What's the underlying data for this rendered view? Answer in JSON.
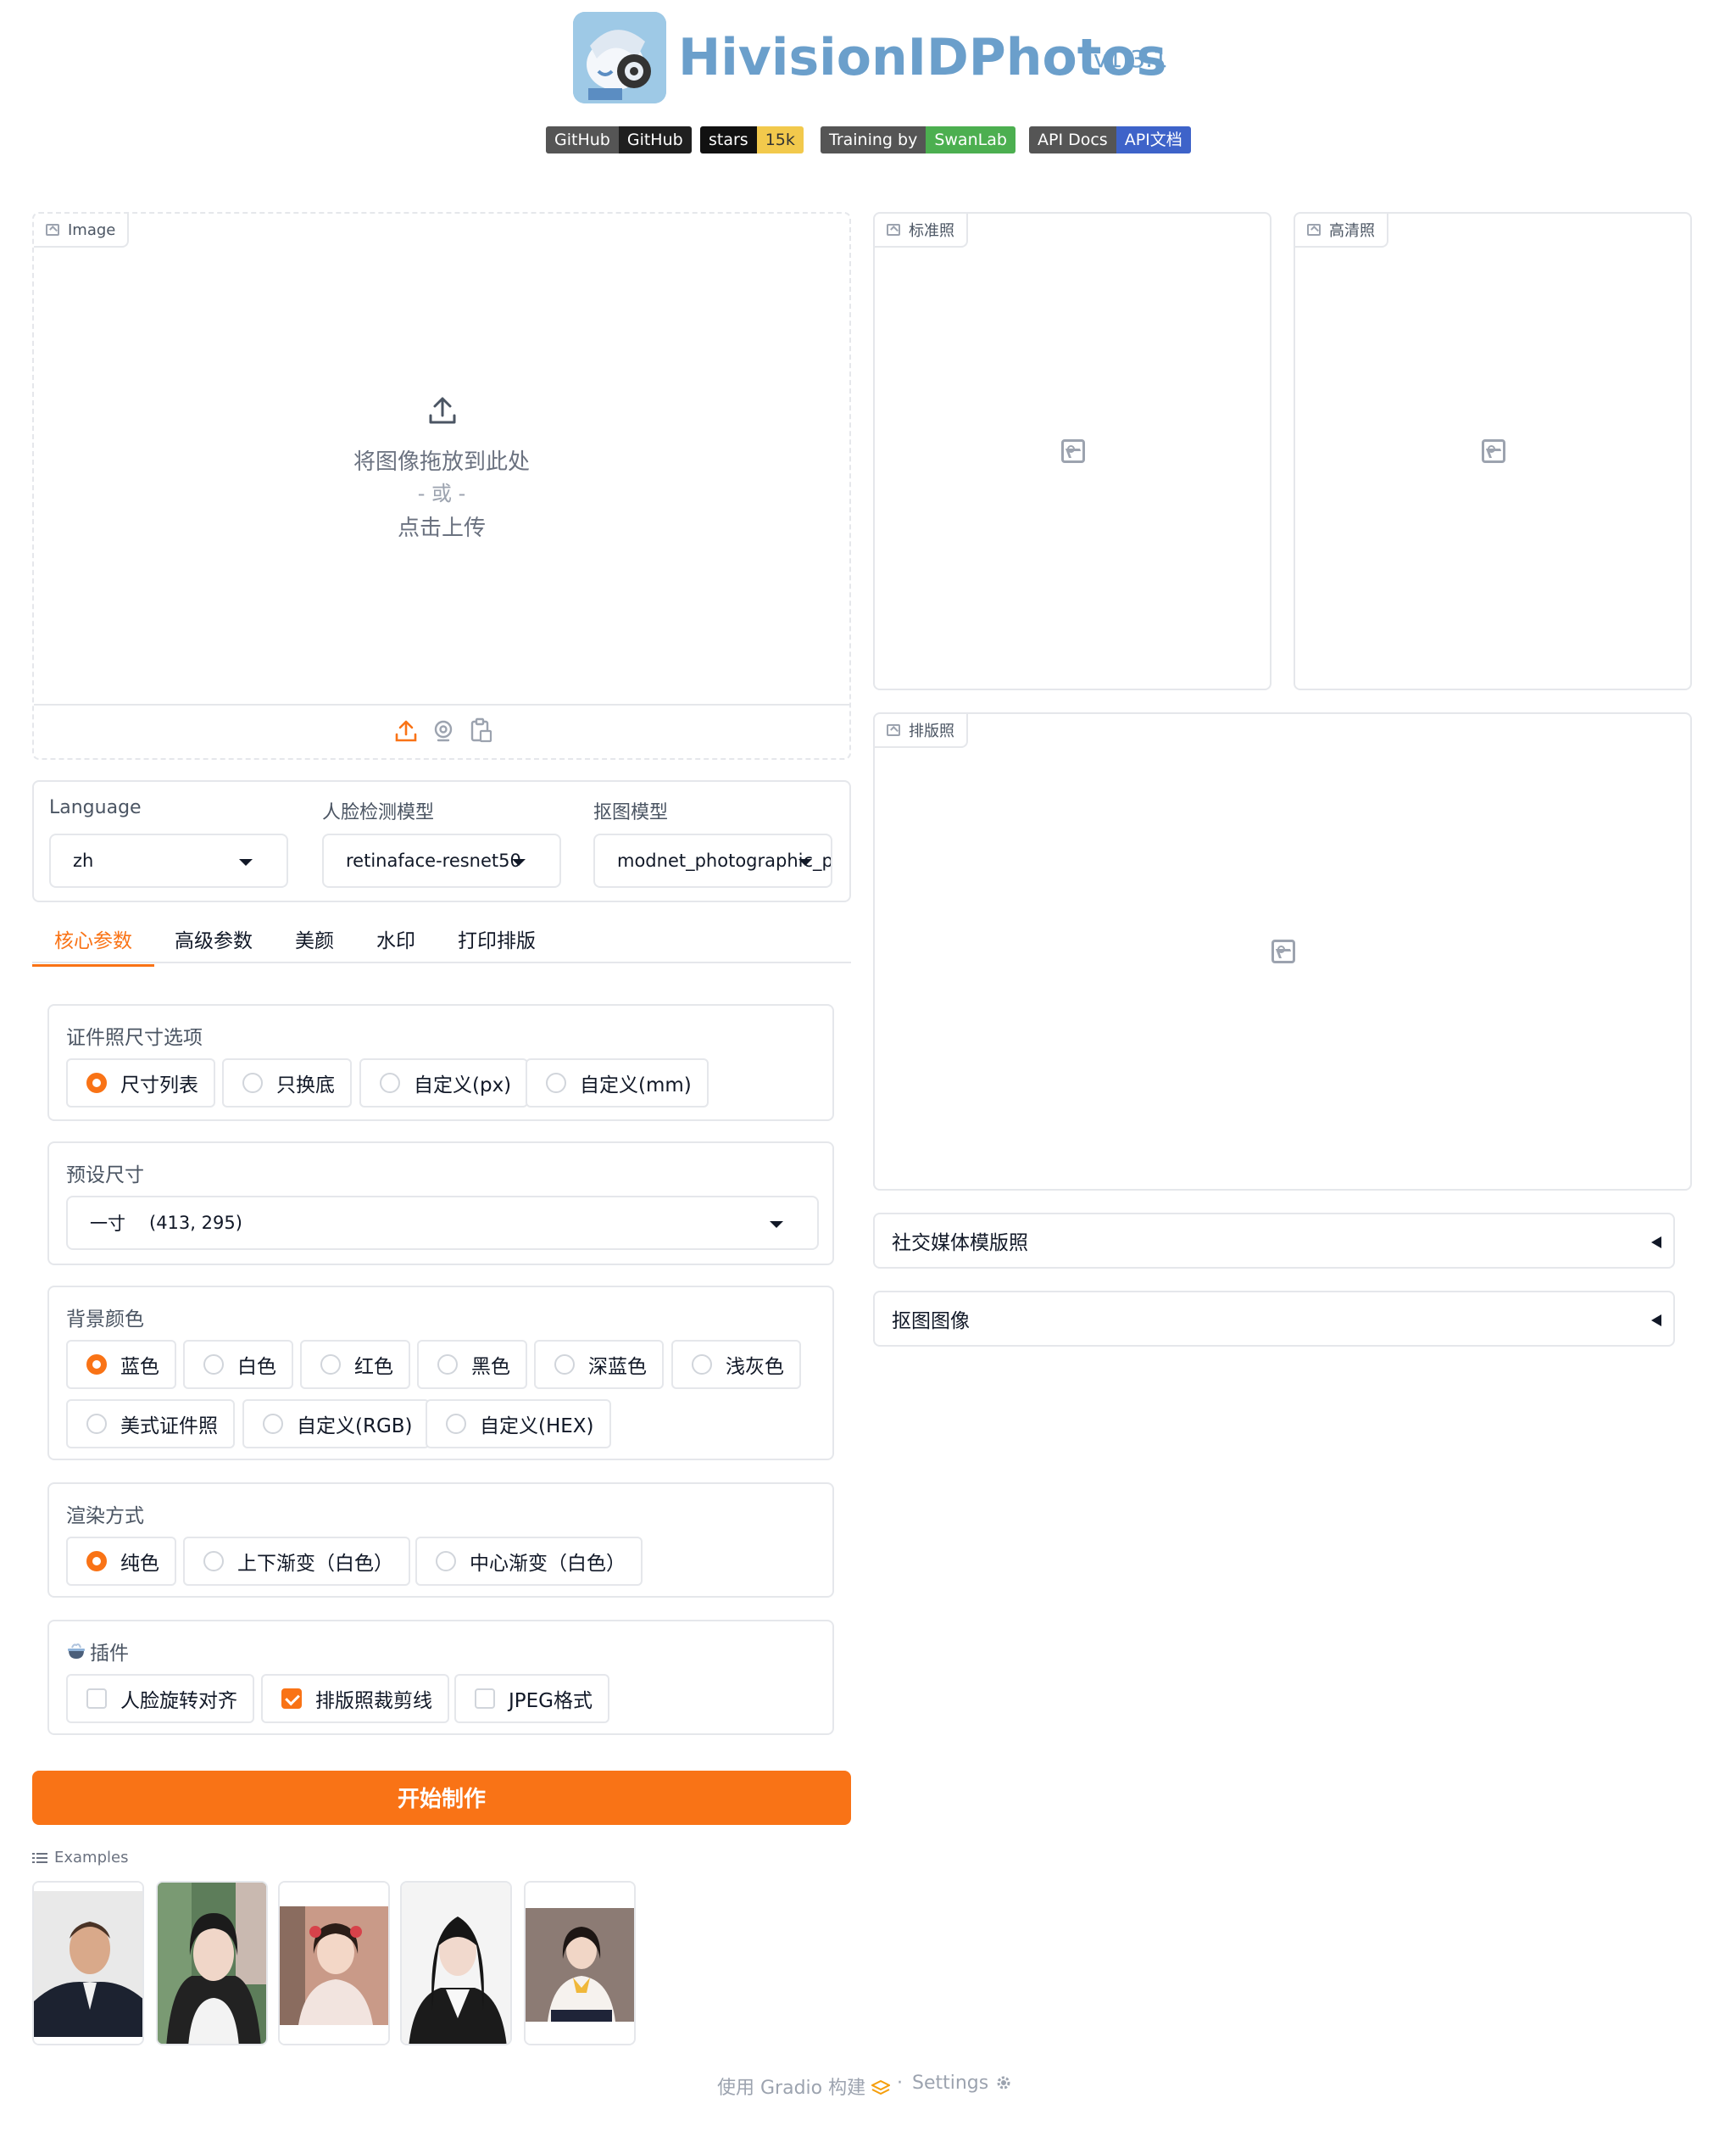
{
  "header": {
    "title": "HivisionIDPhotos",
    "version": "v1.3.1",
    "badges": [
      {
        "left": "GitHub",
        "right": "GitHub",
        "right_color": "#1f1f1f"
      },
      {
        "left": "stars",
        "right": "15k",
        "right_color": "#f2c94c"
      },
      {
        "left": "Training by",
        "right": "SwanLab",
        "right_color": "#4caf50"
      },
      {
        "left": "API Docs",
        "right": "API文档",
        "right_color": "#3e63c9"
      }
    ]
  },
  "input_image": {
    "label": "Image",
    "drop_text": "将图像拖放到此处",
    "or_text": "- 或 -",
    "click_text": "点击上传",
    "source_icons": [
      "upload-icon",
      "webcam-icon",
      "clipboard-icon"
    ]
  },
  "outputs": {
    "standard_label": "标准照",
    "hd_label": "高清照",
    "layout_label": "排版照"
  },
  "models": {
    "language_label": "Language",
    "language_value": "zh",
    "face_model_label": "人脸检测模型",
    "face_model_value": "retinaface-resnet50",
    "matting_model_label": "抠图模型",
    "matting_model_value": "modnet_photographic_portrait_matting"
  },
  "tabs": [
    "核心参数",
    "高级参数",
    "美颜",
    "水印",
    "打印排版"
  ],
  "size_options": {
    "label": "证件照尺寸选项",
    "options": [
      "尺寸列表",
      "只换底",
      "自定义(px)",
      "自定义(mm)"
    ],
    "selected": 0
  },
  "preset_size": {
    "label": "预设尺寸",
    "value": "一寸",
    "dims": "(413, 295)"
  },
  "background_color": {
    "label": "背景颜色",
    "options": [
      "蓝色",
      "白色",
      "红色",
      "黑色",
      "深蓝色",
      "浅灰色",
      "美式证件照",
      "自定义(RGB)",
      "自定义(HEX)"
    ],
    "selected": 0
  },
  "render_mode": {
    "label": "渲染方式",
    "options": [
      "纯色",
      "上下渐变（白色）",
      "中心渐变（白色）"
    ],
    "selected": 0
  },
  "plugins": {
    "label": "插件",
    "options": [
      "人脸旋转对齐",
      "排版照裁剪线",
      "JPEG格式"
    ],
    "checked": [
      false,
      true,
      false
    ]
  },
  "start_button": "开始制作",
  "accordions": [
    "社交媒体模版照",
    "抠图图像"
  ],
  "examples": {
    "label": "Examples",
    "count": 5
  },
  "footer": {
    "built_with": "使用 Gradio 构建",
    "separator": "·",
    "settings": "Settings"
  },
  "colors": {
    "accent": "#f97316",
    "title": "#6b9fcb"
  }
}
